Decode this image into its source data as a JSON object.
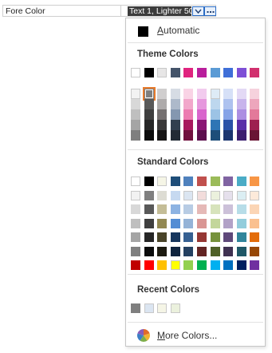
{
  "property": {
    "label": "Fore Color",
    "value": "Text 1, Lighter 50%"
  },
  "picker": {
    "automatic": {
      "label_prefix": "",
      "label_underlined": "A",
      "label_rest": "utomatic",
      "color": "#000000"
    },
    "theme_colors": {
      "title": "Theme Colors",
      "base": [
        "#ffffff",
        "#000000",
        "#e7e6e6",
        "#44546a",
        "#e0247f",
        "#b91e9c",
        "#5b9bd5",
        "#3f6fd8",
        "#7e4fd6",
        "#d1306e"
      ],
      "shades": [
        [
          "#f2f2f2",
          "#7f7f7f",
          "#d0cece",
          "#d6dce4",
          "#f9d3e5",
          "#f2cbee",
          "#deebf6",
          "#d6e0f7",
          "#e3d9f5",
          "#f6d2dd"
        ],
        [
          "#d8d8d8",
          "#595959",
          "#aeabab",
          "#adb9ca",
          "#f2a7cb",
          "#e698dd",
          "#bdd7ee",
          "#aec2ef",
          "#c8b4ec",
          "#eda6bc"
        ],
        [
          "#bfbfbf",
          "#3f3f3f",
          "#757070",
          "#8497b0",
          "#ec7bb1",
          "#d965cc",
          "#9cc3e5",
          "#86a3e7",
          "#ac8ee2",
          "#e3799a"
        ],
        [
          "#a5a5a5",
          "#262626",
          "#3a3838",
          "#323f4f",
          "#a8195e",
          "#8a1674",
          "#2e75b5",
          "#2a52a8",
          "#5a2ea8",
          "#9e2050"
        ],
        [
          "#7f7f7f",
          "#0c0c0c",
          "#171616",
          "#222a35",
          "#70103e",
          "#5c0f4d",
          "#1e4e79",
          "#1c3670",
          "#3c1f70",
          "#691535"
        ]
      ],
      "selected": {
        "row": 0,
        "col": 1
      }
    },
    "standard_colors": {
      "title": "Standard Colors",
      "rows": [
        [
          "#ffffff",
          "#000000",
          "#f5f5e6",
          "#1f4e79",
          "#4f81bd",
          "#c0504d",
          "#9bbb59",
          "#8064a2",
          "#4bacc6",
          "#f79646"
        ],
        [
          "#f2f2f2",
          "#7f7f7f",
          "#dddcd3",
          "#c6d9f0",
          "#dbe5f1",
          "#f2dcdb",
          "#ebf1dd",
          "#e5e0ec",
          "#dbeef3",
          "#fdeada"
        ],
        [
          "#d8d8d8",
          "#595959",
          "#c4bd97",
          "#8db3e2",
          "#b8cce4",
          "#e5b9b7",
          "#d7e3bc",
          "#ccc1d9",
          "#b7dde8",
          "#fbd5b5"
        ],
        [
          "#bfbfbf",
          "#3f3f3f",
          "#938953",
          "#548dd4",
          "#95b3d7",
          "#d99694",
          "#c3d69b",
          "#b2a2c7",
          "#92cddc",
          "#fac08f"
        ],
        [
          "#a5a5a5",
          "#262626",
          "#494429",
          "#17365d",
          "#366092",
          "#953734",
          "#76923c",
          "#5f497a",
          "#31859b",
          "#e36c09"
        ],
        [
          "#7f7f7f",
          "#0c0c0c",
          "#1d1b10",
          "#0f243e",
          "#244061",
          "#632423",
          "#4f6128",
          "#3f3151",
          "#205867",
          "#974806"
        ],
        [
          "#c00000",
          "#ff0000",
          "#ffc000",
          "#ffff00",
          "#92d050",
          "#00b050",
          "#00b0f0",
          "#0070c0",
          "#002060",
          "#7030a0"
        ]
      ]
    },
    "recent_colors": {
      "title": "Recent Colors",
      "colors": [
        "#7f7f7f",
        "#dbe5f1",
        "#f5f5e6",
        "#ebf1dd"
      ]
    },
    "more_colors": {
      "label_underlined": "M",
      "label_rest": "ore Colors..."
    }
  }
}
